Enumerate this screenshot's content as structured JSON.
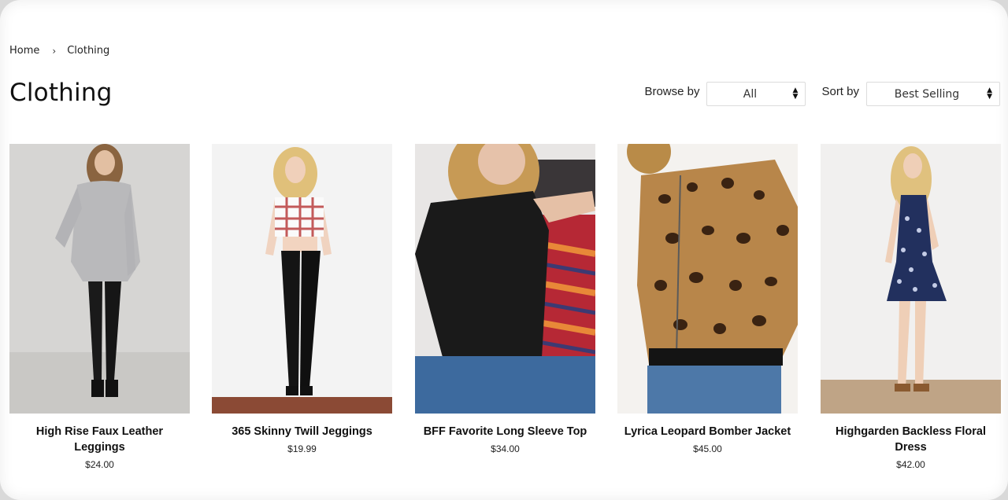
{
  "breadcrumb": {
    "home": "Home",
    "separator": "›",
    "current": "Clothing"
  },
  "page": {
    "title": "Clothing"
  },
  "filters": {
    "browse_label": "Browse by",
    "browse_value": "All",
    "sort_label": "Sort by",
    "sort_value": "Best Selling"
  },
  "products": [
    {
      "name": "High Rise Faux Leather Leggings",
      "price": "$24.00",
      "image_icon": "product-photo-leggings"
    },
    {
      "name": "365 Skinny Twill Jeggings",
      "price": "$19.99",
      "image_icon": "product-photo-jeggings"
    },
    {
      "name": "BFF Favorite Long Sleeve Top",
      "price": "$34.00",
      "image_icon": "product-photo-top"
    },
    {
      "name": "Lyrica Leopard Bomber Jacket",
      "price": "$45.00",
      "image_icon": "product-photo-jacket"
    },
    {
      "name": "Highgarden Backless Floral Dress",
      "price": "$42.00",
      "image_icon": "product-photo-dress"
    }
  ],
  "colors": {
    "background": "#ffffff",
    "text": "#111111"
  }
}
